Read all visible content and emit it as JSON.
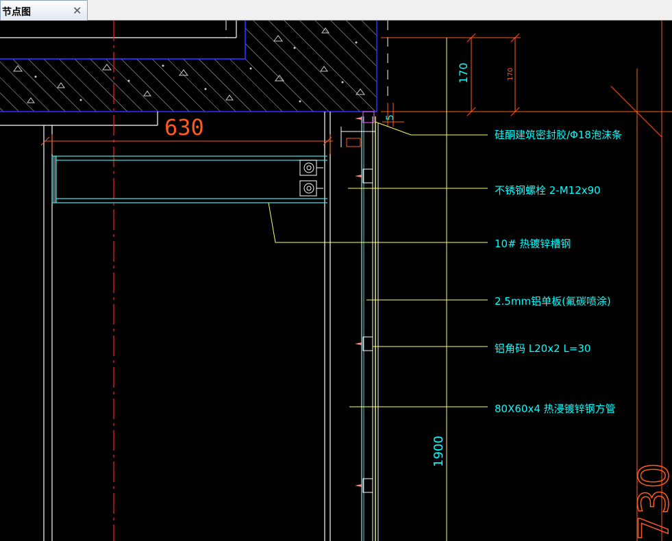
{
  "tab": {
    "title": "节点图",
    "close_glyph": "✕"
  },
  "dimensions": {
    "width_630": "630",
    "slab_170_a": "170",
    "slab_170_b": "170",
    "gap_5": "5",
    "height_1900": "1900",
    "big_730": "730"
  },
  "labels": [
    "硅酮建筑密封胶/Φ18泡沫条",
    "不锈钢螺栓 2-M12x90",
    "10# 热镀锌槽钢",
    "2.5mm铝单板(氟碳喷涂)",
    "铝角码 L20x2 L=30",
    "80X60x4 热浸镀锌钢方管"
  ],
  "colors": {
    "background": "#000000",
    "dimension": "#ff5a1f",
    "annotation_text": "#00ffff",
    "leader": "#ffff66",
    "slab_edge": "#2f2fff",
    "hatch": "#c8c8c8",
    "centerline": "#ff2020",
    "steel": "#40e0e0"
  }
}
